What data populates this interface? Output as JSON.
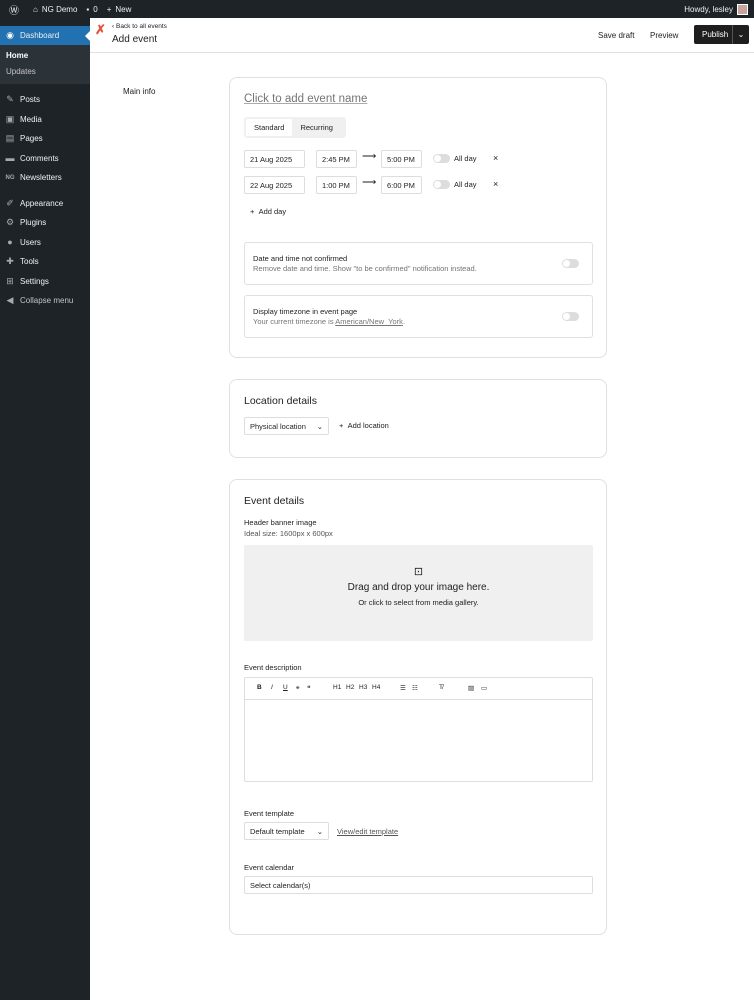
{
  "adminbar": {
    "site": "NG Demo",
    "comments": "0",
    "new": "New",
    "howdy": "Howdy, lesley"
  },
  "sidebar": {
    "dashboard": "Dashboard",
    "home": "Home",
    "updates": "Updates",
    "posts": "Posts",
    "media": "Media",
    "pages": "Pages",
    "comments": "Comments",
    "newsletters": "Newsletters",
    "appearance": "Appearance",
    "plugins": "Plugins",
    "users": "Users",
    "tools": "Tools",
    "settings": "Settings",
    "collapse": "Collapse menu"
  },
  "topbar": {
    "back": "Back to all events",
    "title": "Add event",
    "save_draft": "Save draft",
    "preview": "Preview",
    "publish": "Publish"
  },
  "main_info": {
    "section_label": "Main info",
    "name_placeholder": "Click to add event name",
    "tabs": [
      "Standard",
      "Recurring"
    ],
    "days": [
      {
        "date": "21 Aug 2025",
        "start": "2:45 PM",
        "end": "5:00 PM",
        "allday": "All day"
      },
      {
        "date": "22 Aug 2025",
        "start": "1:00 PM",
        "end": "6:00 PM",
        "allday": "All day"
      }
    ],
    "add_day": "Add day",
    "not_confirmed_title": "Date and time not confirmed",
    "not_confirmed_desc": "Remove date and time. Show \"to be confirmed\" notification instead.",
    "timezone_title": "Display timezone in event page",
    "timezone_desc": "Your current timezone is ",
    "timezone_value": "American/New_York",
    "timezone_end": "."
  },
  "location": {
    "title": "Location details",
    "select": "Physical location",
    "add": "Add location"
  },
  "event_details": {
    "title": "Event details",
    "banner_label": "Header banner image",
    "banner_size": "Ideal size: 1600px x 600px",
    "drop_title": "Drag and drop your image here.",
    "drop_sub": "Or click to select from media gallery.",
    "desc_label": "Event description",
    "toolbar": [
      "B",
      "I",
      "U",
      "H1",
      "H2",
      "H3",
      "H4"
    ],
    "template_label": "Event template",
    "template_value": "Default template",
    "template_link": "View/edit template",
    "calendar_label": "Event calendar",
    "calendar_value": "Select calendar(s)"
  }
}
